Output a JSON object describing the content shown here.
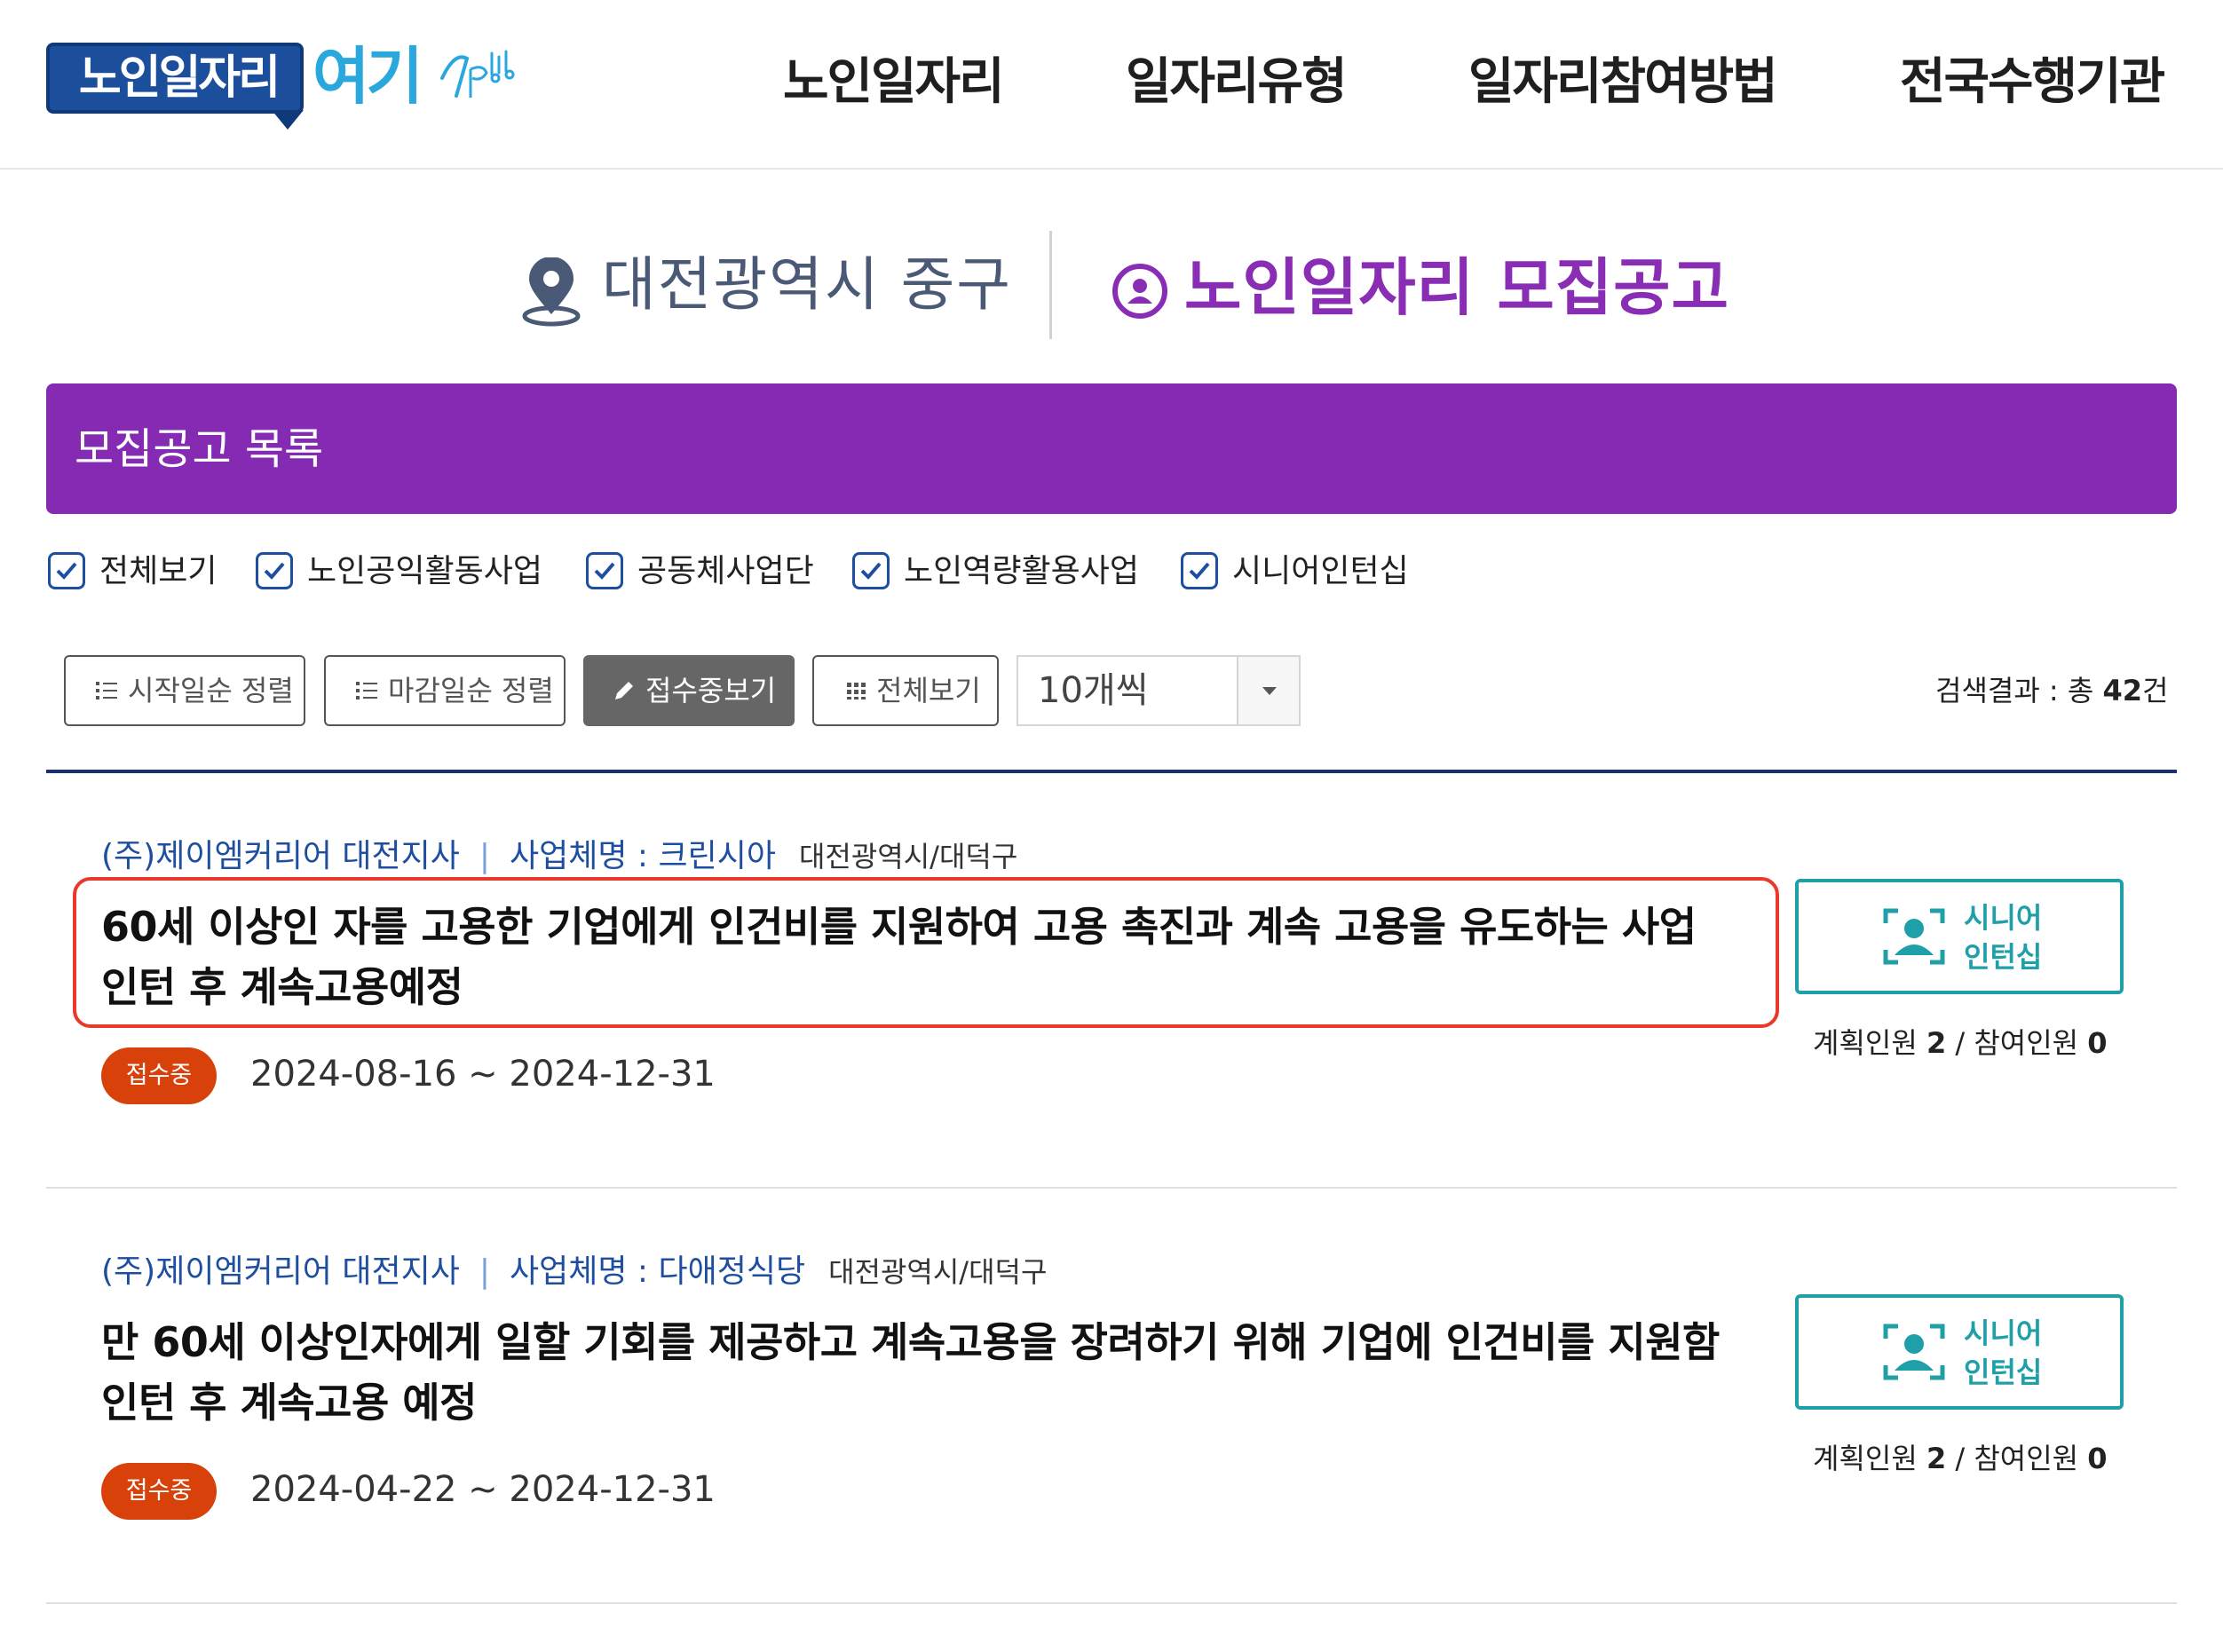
{
  "header": {
    "logo": {
      "main": "노인일자리",
      "accent": "여기"
    },
    "nav": [
      "노인일자리",
      "일자리유형",
      "일자리참여방법",
      "전국수행기관"
    ]
  },
  "location": {
    "text": "대전광역시 중구",
    "icon": "location-pin-icon"
  },
  "page_title": {
    "text": "노인일자리 모집공고",
    "icon": "person-circle-icon",
    "color": "#8a2db5"
  },
  "banner": {
    "text": "모집공고 목록",
    "color": "#852bb3"
  },
  "filters": [
    {
      "label": "전체보기",
      "checked": true
    },
    {
      "label": "노인공익활동사업",
      "checked": true
    },
    {
      "label": "공동체사업단",
      "checked": true
    },
    {
      "label": "노인역량활용사업",
      "checked": true
    },
    {
      "label": "시니어인턴십",
      "checked": true
    }
  ],
  "toolbar": {
    "sort_start": "시작일순 정렬",
    "sort_end": "마감일순 정렬",
    "accepting": "접수중보기",
    "view_all": "전체보기",
    "page_size": "10개씩",
    "result_prefix": "검색결과 : 총 ",
    "result_count": "42",
    "result_suffix": "건"
  },
  "jobs": [
    {
      "org": "(주)제이엠커리어 대전지사",
      "separator": "|",
      "business": "사업체명 : 크린시아",
      "region": "대전광역시/대덕구",
      "title_line1": "60세 이상인 자를 고용한 기업에게 인건비를 지원하여 고용 촉진과 계속 고용을 유도하는 사업",
      "title_line2": "인턴 후 계속고용예정",
      "status": "접수중",
      "dates": "2024-08-16 ~ 2024-12-31",
      "type_line1": "시니어",
      "type_line2": "인턴십",
      "people_planned_label": "계획인원 ",
      "people_planned": "2",
      "people_sep": " / ",
      "people_joined_label": "참여인원 ",
      "people_joined": "0",
      "highlighted": true
    },
    {
      "org": "(주)제이엠커리어 대전지사",
      "separator": "|",
      "business": "사업체명 : 다애정식당",
      "region": "대전광역시/대덕구",
      "title_line1": "만 60세 이상인자에게 일할 기회를 제공하고 계속고용을 장려하기 위해 기업에 인건비를 지원함",
      "title_line2": "인턴 후 계속고용 예정",
      "status": "접수중",
      "dates": "2024-04-22 ~ 2024-12-31",
      "type_line1": "시니어",
      "type_line2": "인턴십",
      "people_planned_label": "계획인원 ",
      "people_planned": "2",
      "people_sep": " / ",
      "people_joined_label": "참여인원 ",
      "people_joined": "0",
      "highlighted": false
    }
  ]
}
